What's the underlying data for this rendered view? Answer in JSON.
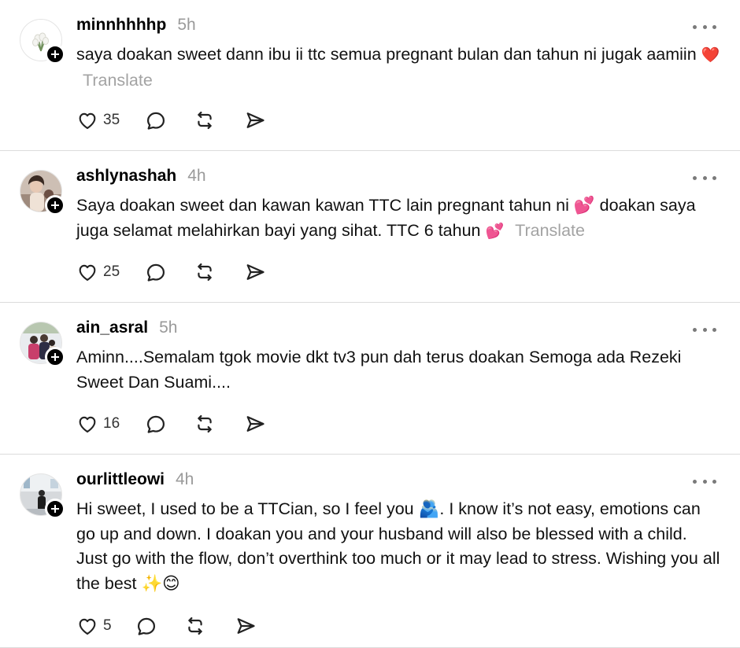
{
  "posts": [
    {
      "username": "minnhhhhp",
      "time": "5h",
      "text": "saya doakan sweet dann ibu ii ttc semua pregnant bulan dan tahun ni jugak aamiin",
      "emoji": "❤️",
      "translate": "Translate",
      "likes": "35"
    },
    {
      "username": "ashlynashah",
      "time": "4h",
      "text": "Saya doakan sweet dan kawan kawan TTC lain pregnant tahun ni 💕 doakan saya juga selamat melahirkan bayi yang sihat. TTC 6 tahun",
      "emoji": "💕",
      "translate": "Translate",
      "likes": "25"
    },
    {
      "username": "ain_asral",
      "time": "5h",
      "text": "Aminn....Semalam tgok movie dkt tv3 pun dah terus doakan Semoga ada Rezeki Sweet Dan Suami....",
      "likes": "16"
    },
    {
      "username": "ourlittleowi",
      "time": "4h",
      "text": "Hi sweet, I used to be a TTCian, so I feel you 🫂. I know it’s not easy, emotions can go up and down. I doakan you and your husband will also be blessed with a child. Just go with the flow, don’t overthink too much or it may lead to stress. Wishing you all the best ✨😊",
      "likes": "5"
    }
  ],
  "icons": {
    "like": "heart-icon",
    "reply": "comment-bubble-icon",
    "repost": "repost-icon",
    "share": "send-icon",
    "more": "more-dots-icon",
    "follow": "plus-icon"
  }
}
